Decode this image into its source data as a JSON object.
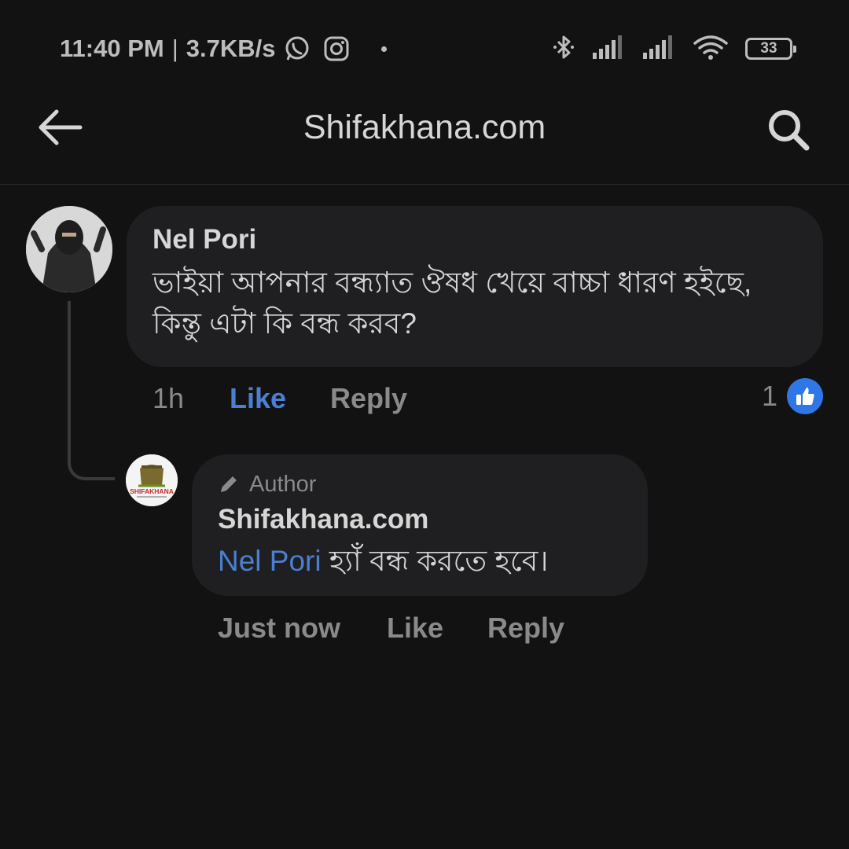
{
  "status_bar": {
    "time": "11:40 PM",
    "separator": "|",
    "speed": "3.7KB/s",
    "battery": "33",
    "icons": [
      "whatsapp-icon",
      "instagram-icon",
      "bluetooth-icon",
      "signal-icon",
      "signal-icon",
      "wifi-icon",
      "battery-icon"
    ]
  },
  "app_bar": {
    "title": "Shifakhana.com",
    "back_icon": "arrow-left-icon",
    "search_icon": "search-icon"
  },
  "comment": {
    "author": "Nel Pori",
    "text": "ভাইয়া আপনার বন্ধ্যাত ঔষধ খেয়ে বাচ্চা ধারণ হইছে, কিন্তু এটা কি বন্ধ করব?",
    "time": "1h",
    "like_label": "Like",
    "reply_label": "Reply",
    "reaction_count": "1",
    "liked": true,
    "colors": {
      "like_active": "#4a7fd1",
      "reaction_badge": "#2f77e6"
    }
  },
  "reply": {
    "badge": "Author",
    "author": "Shifakhana.com",
    "mention": "Nel Pori",
    "text": " হ্যাঁ বন্ধ করতে হবে।",
    "time": "Just now",
    "like_label": "Like",
    "reply_label": "Reply",
    "avatar_logo_text": "SHIFAKHANA"
  }
}
